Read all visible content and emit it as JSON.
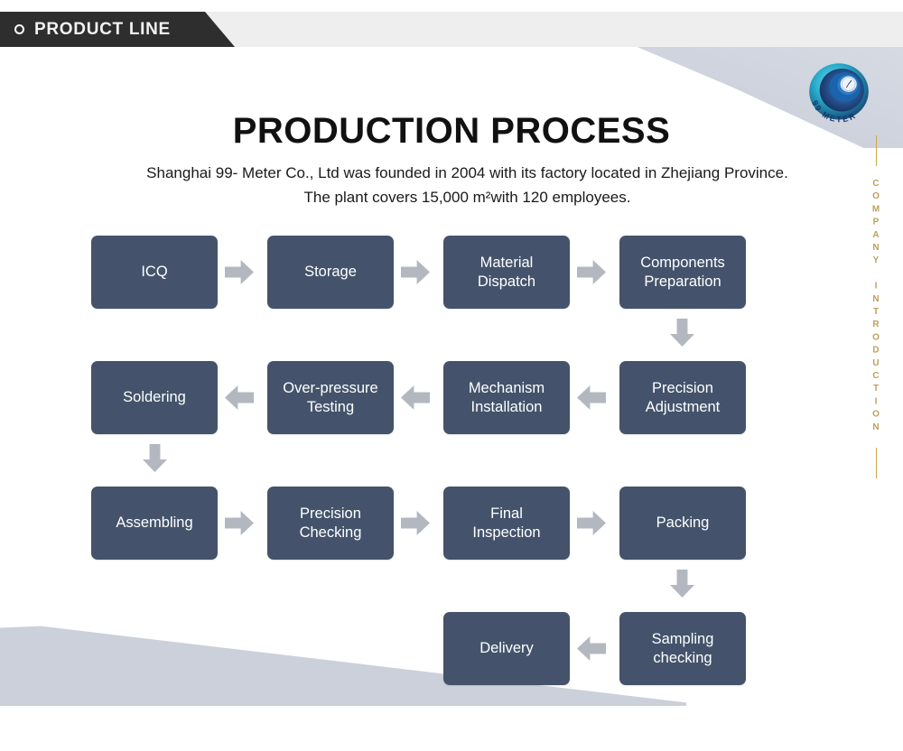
{
  "header": {
    "tab_label": "PRODUCT LINE",
    "dot_icon": "circle-outline-icon",
    "band_color": "#eeeeee",
    "tab_color": "#2e2e2e"
  },
  "logo": {
    "name": "99-meter-logo",
    "brand_text": "99 METER",
    "colors": {
      "outer": "#1f8fb5",
      "mid": "#2ab5c9",
      "inner": "#2f5fa8",
      "deep": "#123a6b"
    }
  },
  "side_rail": {
    "text": "COMPANY INTRODUCTION",
    "color": "#bda05c"
  },
  "page": {
    "title": "PRODUCTION PROCESS",
    "subtitle": "Shanghai 99- Meter Co., Ltd was founded in 2004 with its factory located in Zhejiang Province. The plant covers 15,000 m²with 120 employees."
  },
  "colors": {
    "box_fill": "#44536b",
    "box_text": "#ffffff",
    "arrow_fill": "#b3b7c0",
    "decor_polygon": "#ccd0da",
    "accent_gold": "#c9a74b"
  },
  "flow": {
    "type": "process-flowchart",
    "rows": [
      {
        "direction": "left-to-right",
        "steps": [
          "ICQ",
          "Storage",
          "Material Dispatch",
          "Components Preparation"
        ]
      },
      {
        "direction": "right-to-left",
        "steps": [
          "Precision Adjustment",
          "Mechanism Installation",
          "Over-pressure Testing",
          "Soldering"
        ]
      },
      {
        "direction": "left-to-right",
        "steps": [
          "Assembling",
          "Precision Checking",
          "Final Inspection",
          "Packing"
        ]
      },
      {
        "direction": "right-to-left",
        "steps": [
          "Sampling checking",
          "Delivery"
        ]
      }
    ],
    "boxes": {
      "icq": "ICQ",
      "storage": "Storage",
      "material_dispatch_l1": "Material",
      "material_dispatch_l2": "Dispatch",
      "components_prep_l1": "Components",
      "components_prep_l2": "Preparation",
      "soldering": "Soldering",
      "overpressure_l1": "Over-pressure",
      "overpressure_l2": "Testing",
      "mechanism_l1": "Mechanism",
      "mechanism_l2": "Installation",
      "precision_adj_l1": "Precision",
      "precision_adj_l2": "Adjustment",
      "assembling": "Assembling",
      "precision_check_l1": "Precision",
      "precision_check_l2": "Checking",
      "final_insp_l1": "Final",
      "final_insp_l2": "Inspection",
      "packing": "Packing",
      "delivery": "Delivery",
      "sampling_l1": "Sampling",
      "sampling_l2": "checking"
    }
  }
}
